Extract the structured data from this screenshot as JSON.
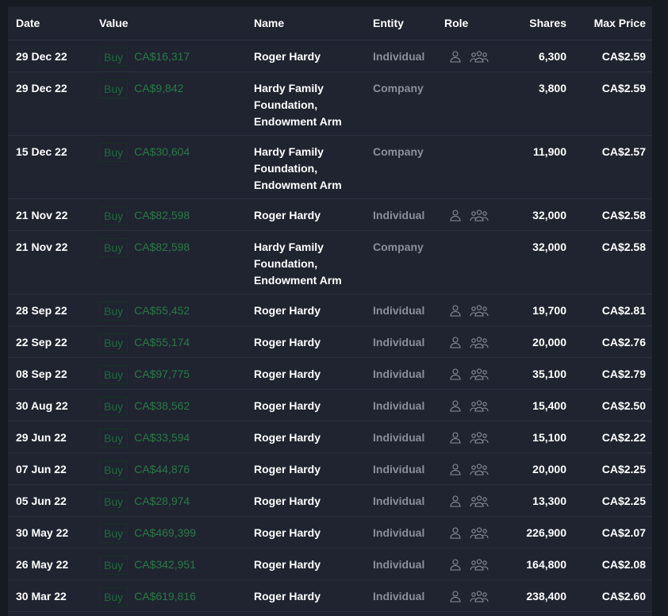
{
  "columns": {
    "date": "Date",
    "value": "Value",
    "name": "Name",
    "entity": "Entity",
    "role": "Role",
    "shares": "Shares",
    "max_price": "Max Price"
  },
  "rows": [
    {
      "date": "29 Dec 22",
      "type": "Buy",
      "value": "CA$16,317",
      "name": "Roger Hardy",
      "entity": "Individual",
      "role_icons": [
        "person-icon",
        "group-icon"
      ],
      "shares": "6,300",
      "price": "CA$2.59"
    },
    {
      "date": "29 Dec 22",
      "type": "Buy",
      "value": "CA$9,842",
      "name": "Hardy Family Foundation, Endowment Arm",
      "entity": "Company",
      "role_icons": [],
      "shares": "3,800",
      "price": "CA$2.59"
    },
    {
      "date": "15 Dec 22",
      "type": "Buy",
      "value": "CA$30,604",
      "name": "Hardy Family Foundation, Endowment Arm",
      "entity": "Company",
      "role_icons": [],
      "shares": "11,900",
      "price": "CA$2.57"
    },
    {
      "date": "21 Nov 22",
      "type": "Buy",
      "value": "CA$82,598",
      "name": "Roger Hardy",
      "entity": "Individual",
      "role_icons": [
        "person-icon",
        "group-icon"
      ],
      "shares": "32,000",
      "price": "CA$2.58"
    },
    {
      "date": "21 Nov 22",
      "type": "Buy",
      "value": "CA$82,598",
      "name": "Hardy Family Foundation, Endowment Arm",
      "entity": "Company",
      "role_icons": [],
      "shares": "32,000",
      "price": "CA$2.58"
    },
    {
      "date": "28 Sep 22",
      "type": "Buy",
      "value": "CA$55,452",
      "name": "Roger Hardy",
      "entity": "Individual",
      "role_icons": [
        "person-icon",
        "group-icon"
      ],
      "shares": "19,700",
      "price": "CA$2.81"
    },
    {
      "date": "22 Sep 22",
      "type": "Buy",
      "value": "CA$55,174",
      "name": "Roger Hardy",
      "entity": "Individual",
      "role_icons": [
        "person-icon",
        "group-icon"
      ],
      "shares": "20,000",
      "price": "CA$2.76"
    },
    {
      "date": "08 Sep 22",
      "type": "Buy",
      "value": "CA$97,775",
      "name": "Roger Hardy",
      "entity": "Individual",
      "role_icons": [
        "person-icon",
        "group-icon"
      ],
      "shares": "35,100",
      "price": "CA$2.79"
    },
    {
      "date": "30 Aug 22",
      "type": "Buy",
      "value": "CA$38,562",
      "name": "Roger Hardy",
      "entity": "Individual",
      "role_icons": [
        "person-icon",
        "group-icon"
      ],
      "shares": "15,400",
      "price": "CA$2.50"
    },
    {
      "date": "29 Jun 22",
      "type": "Buy",
      "value": "CA$33,594",
      "name": "Roger Hardy",
      "entity": "Individual",
      "role_icons": [
        "person-icon",
        "group-icon"
      ],
      "shares": "15,100",
      "price": "CA$2.22"
    },
    {
      "date": "07 Jun 22",
      "type": "Buy",
      "value": "CA$44,876",
      "name": "Roger Hardy",
      "entity": "Individual",
      "role_icons": [
        "person-icon",
        "group-icon"
      ],
      "shares": "20,000",
      "price": "CA$2.25"
    },
    {
      "date": "05 Jun 22",
      "type": "Buy",
      "value": "CA$28,974",
      "name": "Roger Hardy",
      "entity": "Individual",
      "role_icons": [
        "person-icon",
        "group-icon"
      ],
      "shares": "13,300",
      "price": "CA$2.25"
    },
    {
      "date": "30 May 22",
      "type": "Buy",
      "value": "CA$469,399",
      "name": "Roger Hardy",
      "entity": "Individual",
      "role_icons": [
        "person-icon",
        "group-icon"
      ],
      "shares": "226,900",
      "price": "CA$2.07"
    },
    {
      "date": "26 May 22",
      "type": "Buy",
      "value": "CA$342,951",
      "name": "Roger Hardy",
      "entity": "Individual",
      "role_icons": [
        "person-icon",
        "group-icon"
      ],
      "shares": "164,800",
      "price": "CA$2.08"
    },
    {
      "date": "30 Mar 22",
      "type": "Buy",
      "value": "CA$619,816",
      "name": "Roger Hardy",
      "entity": "Individual",
      "role_icons": [
        "person-icon",
        "group-icon"
      ],
      "shares": "238,400",
      "price": "CA$2.60"
    }
  ],
  "colors": {
    "background": "#161a23",
    "panel": "#1f2430",
    "buy_text": "#1e6b3a",
    "value_text": "#2a7a45",
    "muted_text": "#8a8f99",
    "row_divider": "#2b3140"
  }
}
